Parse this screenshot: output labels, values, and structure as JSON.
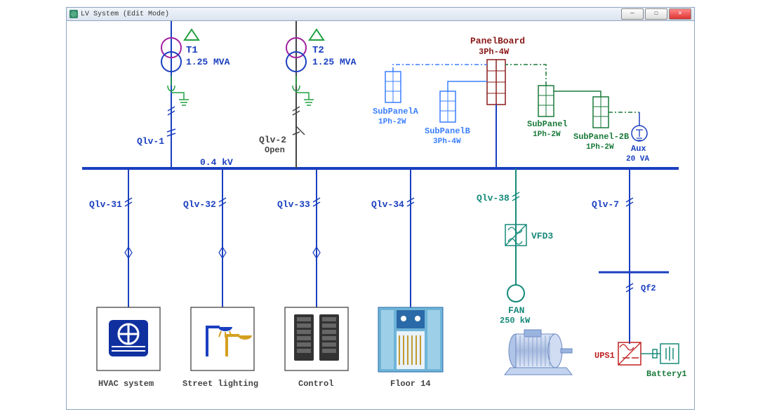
{
  "window": {
    "title": "LV System (Edit Mode)"
  },
  "bus": {
    "voltage": "0.4 kV"
  },
  "transformers": {
    "t1": {
      "name": "T1",
      "rating": "1.25 MVA"
    },
    "t2": {
      "name": "T2",
      "rating": "1.25 MVA"
    }
  },
  "breakers": {
    "qlv1": "Qlv-1",
    "qlv2": "Qlv-2",
    "qlv2_state": "Open",
    "qlv31": "Qlv-31",
    "qlv32": "Qlv-32",
    "qlv33": "Qlv-33",
    "qlv34": "Qlv-34",
    "qlv38": "Qlv-38",
    "qlv7": "Qlv-7",
    "qf2": "Qf2"
  },
  "panels": {
    "main": {
      "name": "PanelBoard",
      "cfg": "3Ph-4W"
    },
    "subA": {
      "name": "SubPanelA",
      "cfg": "1Ph-2W"
    },
    "subB": {
      "name": "SubPanelB",
      "cfg": "3Ph-4W"
    },
    "sub1": {
      "name": "SubPanel",
      "cfg": "1Ph-2W"
    },
    "sub2b": {
      "name": "SubPanel-2B",
      "cfg": "1Ph-2W"
    }
  },
  "aux": {
    "name": "Aux",
    "rating": "20 VA"
  },
  "vfd": {
    "name": "VFD3"
  },
  "fan": {
    "name": "FAN",
    "rating": "250 kW"
  },
  "ups": {
    "name": "UPS1"
  },
  "battery": {
    "name": "Battery1"
  },
  "loads": {
    "hvac": "HVAC system",
    "street": "Street lighting",
    "control": "Control",
    "floor": "Floor 14"
  }
}
